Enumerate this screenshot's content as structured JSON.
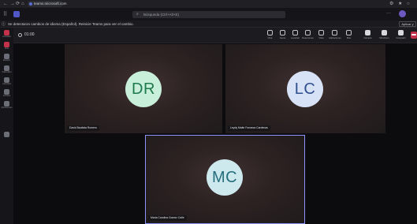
{
  "browser": {
    "url": "teams.microsoft.com",
    "nav_back": "←",
    "nav_forward": "→",
    "nav_reload": "⟳",
    "nav_home": "⌂",
    "ctrl_settings": "⚙",
    "ctrl_star": "★",
    "ctrl_profile": "○"
  },
  "teams_header": {
    "grid_glyph": "⠿",
    "search_icon": "⌕",
    "search_placeholder": "Búsqueda (Ctrl+Alt+E)",
    "more_glyph": "···"
  },
  "notice": {
    "icon_glyph": "ⓘ",
    "text": "Se detectaron cambios de idioma (Español). Reinicie Teams para ver el cambio.",
    "button_label": "Aplicar y reiniciar"
  },
  "rail": {
    "items": [
      {
        "label": "Actividad"
      },
      {
        "label": "Chat"
      },
      {
        "label": "Equipos"
      },
      {
        "label": "Calendario"
      },
      {
        "label": "Llamadas"
      },
      {
        "label": "Archivos"
      },
      {
        "label": "Aplicaciones"
      }
    ]
  },
  "meeting": {
    "timer": "01:00",
    "toolbar": [
      {
        "label": "Chat"
      },
      {
        "label": "Gente"
      },
      {
        "label": "Levantar"
      },
      {
        "label": "Reacciones"
      },
      {
        "label": "Vista"
      },
      {
        "label": "Aplicaciones"
      },
      {
        "label": "Más"
      }
    ],
    "controls": [
      {
        "label": "Cámara"
      },
      {
        "label": "Micrófono"
      },
      {
        "label": "Compartir"
      }
    ]
  },
  "participants": [
    {
      "initials": "DR",
      "name": "David Bautista Romero",
      "avatar_bg": "#c7efd9",
      "avatar_fg": "#1f7a4d"
    },
    {
      "initials": "LC",
      "name": "Leydy Maite Fonseca Cardenas",
      "avatar_bg": "#d8e2f7",
      "avatar_fg": "#2f4f8f"
    },
    {
      "initials": "MC",
      "name": "Maria Carolina Gomez Calle",
      "avatar_bg": "#cde9ee",
      "avatar_fg": "#256e7c"
    }
  ],
  "colors": {
    "accent": "#5b5fc7",
    "leave": "#c4314b",
    "active_speaker": "#8d92ff"
  }
}
